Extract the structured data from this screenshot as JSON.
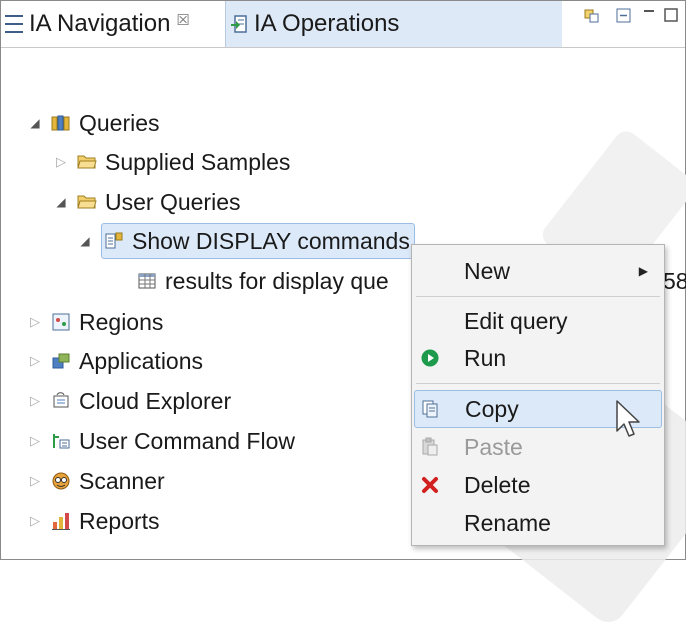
{
  "tabs": [
    {
      "label": "IA Navigation",
      "close": "☒",
      "active": true
    },
    {
      "label": "IA Operations",
      "active": false
    }
  ],
  "tree": {
    "queries": "Queries",
    "supplied_samples": "Supplied Samples",
    "user_queries": "User Queries",
    "show_display": "Show DISPLAY commands",
    "results": "results for display que",
    "results_suffix": "58",
    "regions": "Regions",
    "applications": "Applications",
    "cloud_explorer": "Cloud Explorer",
    "user_command_flow": "User Command Flow",
    "scanner": "Scanner",
    "reports": "Reports"
  },
  "context_menu": {
    "new": "New",
    "edit_query": "Edit query",
    "run": "Run",
    "copy": "Copy",
    "paste": "Paste",
    "delete": "Delete",
    "rename": "Rename"
  },
  "colors": {
    "selection": "#dce9f8",
    "accent": "#3e5e87",
    "run_green": "#1e9a4c",
    "delete_red": "#d21f1f"
  }
}
